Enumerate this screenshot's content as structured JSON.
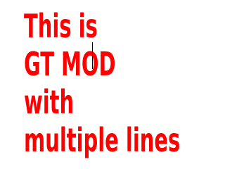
{
  "text_area": {
    "lines": [
      "This is",
      "GT MOD",
      "with",
      "multiple lines"
    ],
    "text_color": "#ff0000"
  }
}
